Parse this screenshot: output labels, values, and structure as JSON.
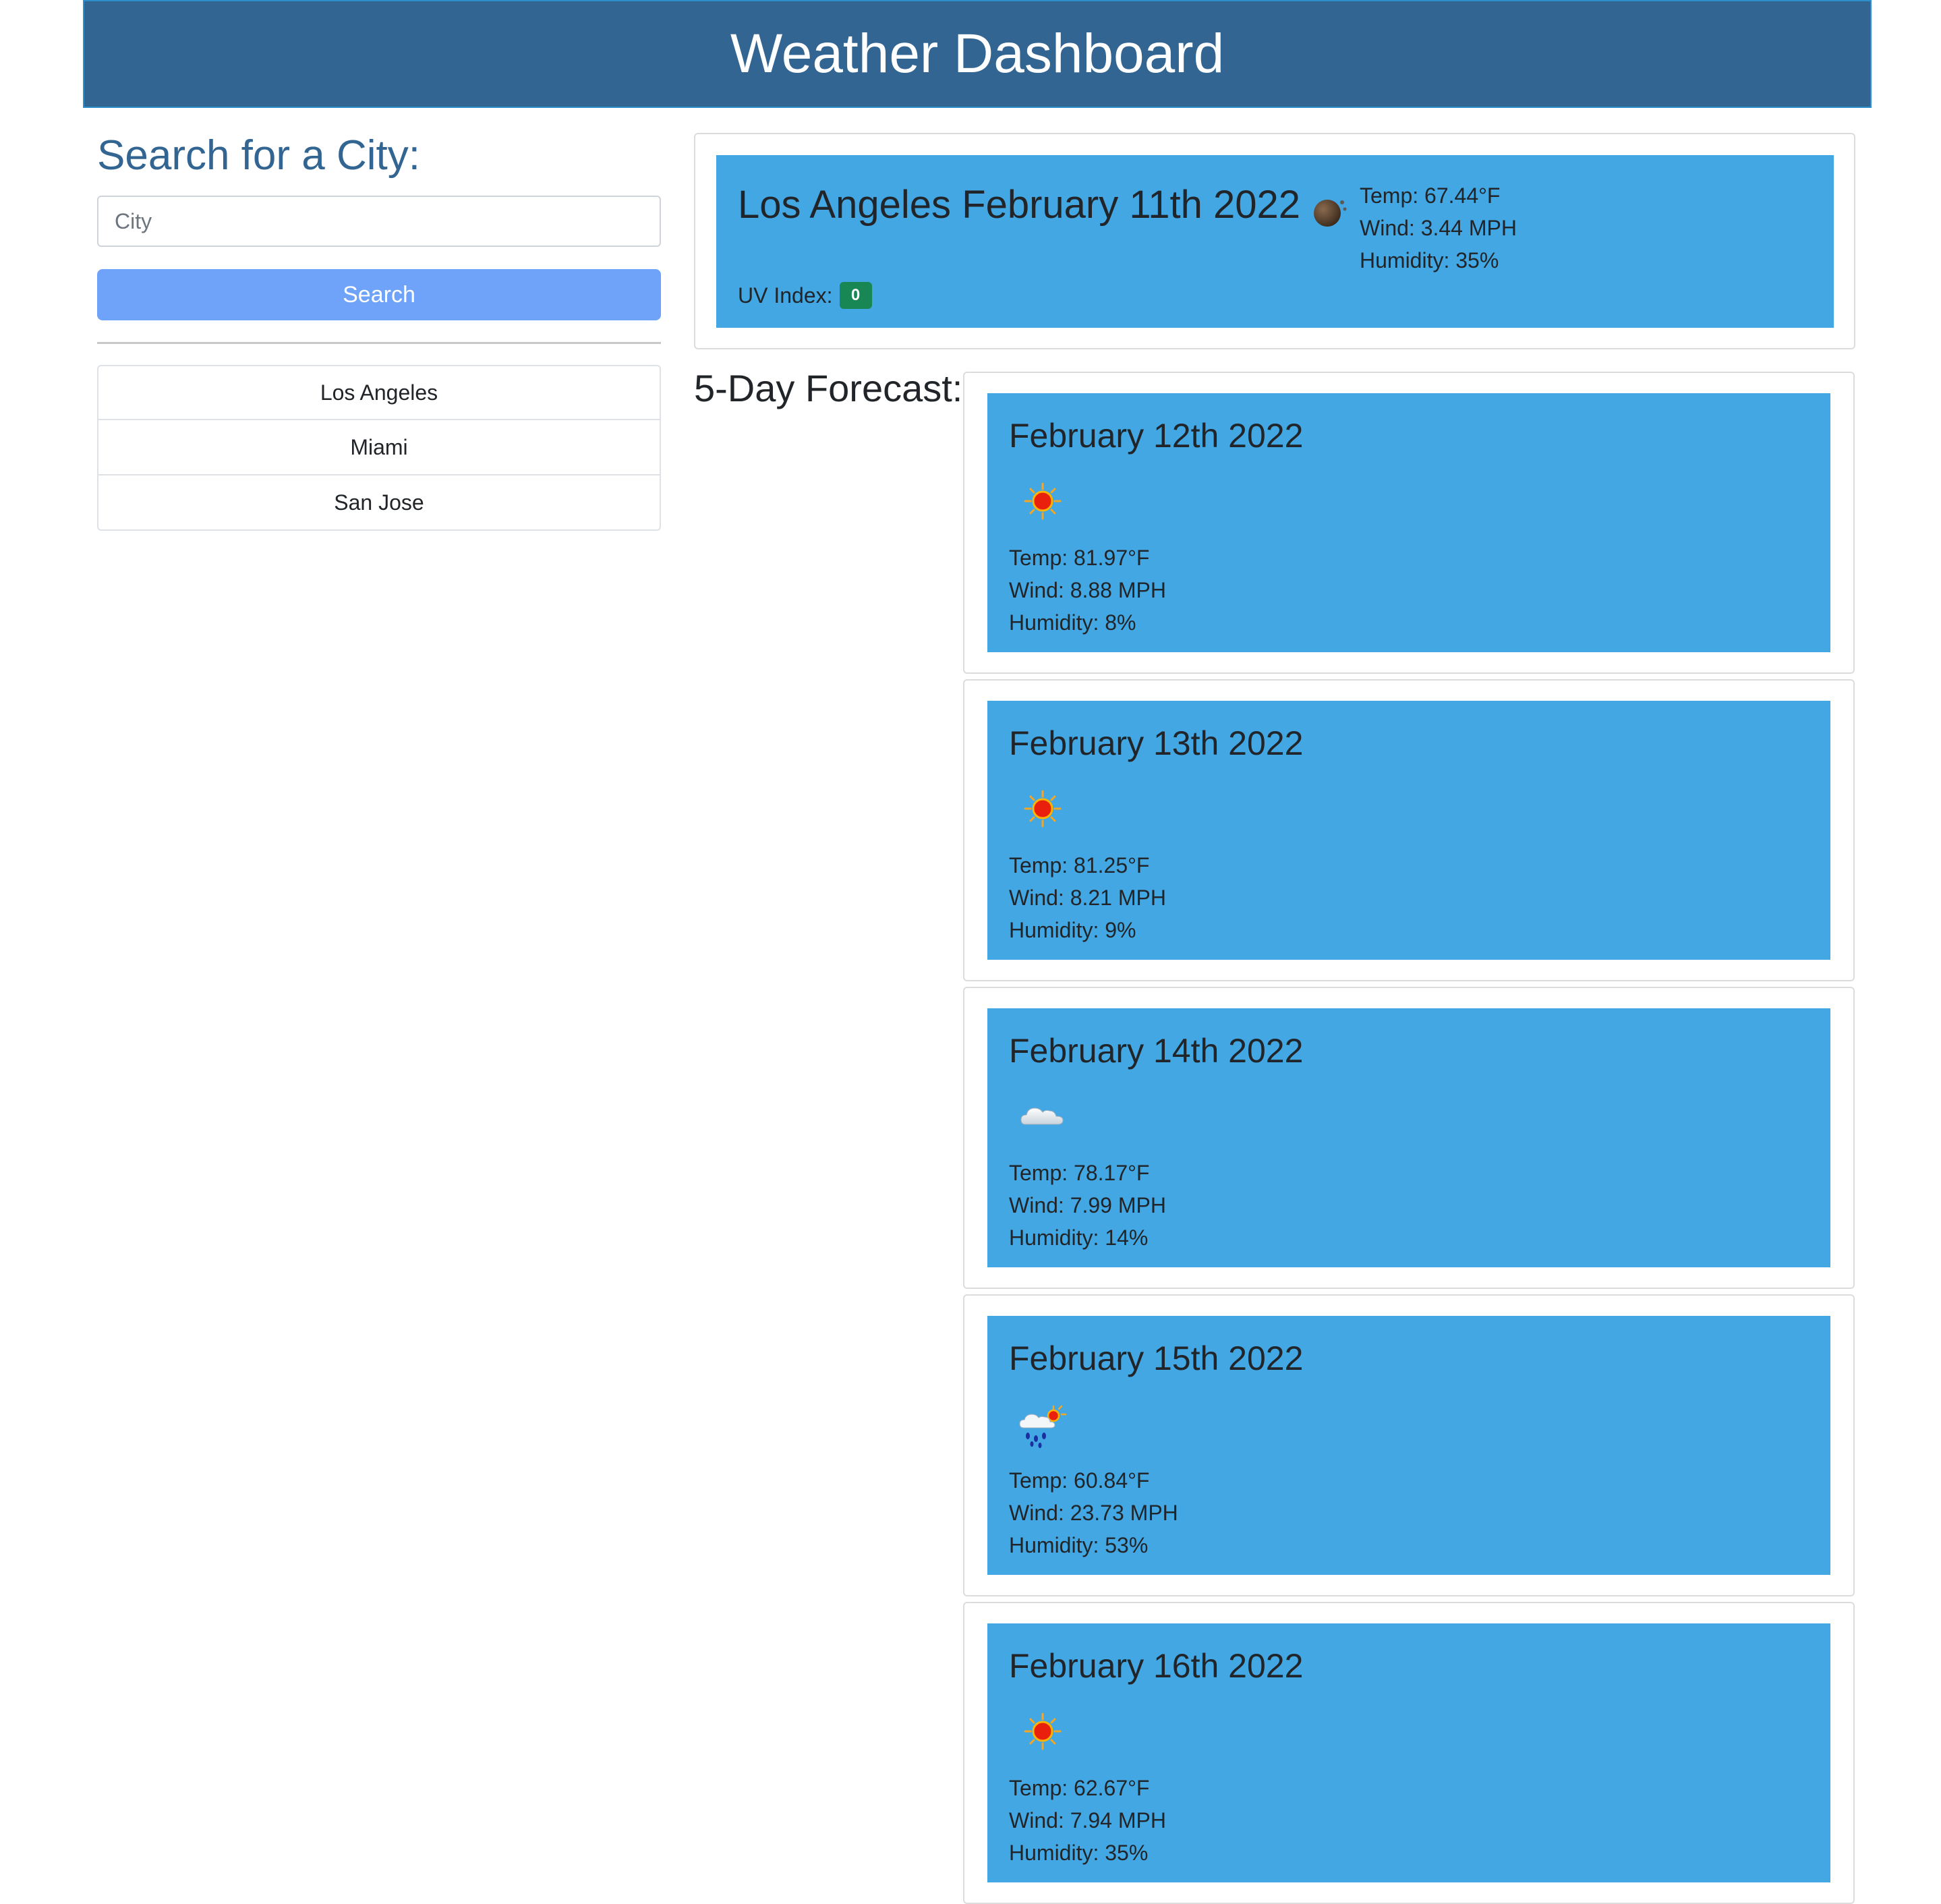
{
  "header": {
    "title": "Weather Dashboard"
  },
  "search": {
    "title": "Search for a City:",
    "placeholder": "City",
    "value": "",
    "button_label": "Search"
  },
  "history": [
    "Los Angeles",
    "Miami",
    "San Jose"
  ],
  "current": {
    "heading": "Los Angeles February 11th 2022",
    "icon": "night-clear-icon",
    "temp": "Temp: 67.44°F",
    "wind": "Wind: 3.44 MPH",
    "humidity": "Humidity: 35%",
    "uv_label": "UV Index:",
    "uv_value": "0",
    "uv_color": "#198754"
  },
  "forecast_title": "5-Day Forecast:",
  "forecast": [
    {
      "date": "February 12th 2022",
      "icon": "sun-icon",
      "temp": "Temp: 81.97°F",
      "wind": "Wind: 8.88 MPH",
      "humidity": "Humidity: 8%"
    },
    {
      "date": "February 13th 2022",
      "icon": "sun-icon",
      "temp": "Temp: 81.25°F",
      "wind": "Wind: 8.21 MPH",
      "humidity": "Humidity: 9%"
    },
    {
      "date": "February 14th 2022",
      "icon": "cloud-icon",
      "temp": "Temp: 78.17°F",
      "wind": "Wind: 7.99 MPH",
      "humidity": "Humidity: 14%"
    },
    {
      "date": "February 15th 2022",
      "icon": "rain-sun-icon",
      "temp": "Temp: 60.84°F",
      "wind": "Wind: 23.73 MPH",
      "humidity": "Humidity: 53%"
    },
    {
      "date": "February 16th 2022",
      "icon": "sun-icon",
      "temp": "Temp: 62.67°F",
      "wind": "Wind: 7.94 MPH",
      "humidity": "Humidity: 35%"
    }
  ],
  "colors": {
    "header_bg": "#336592",
    "card_bg": "#42a7e2",
    "search_button": "#6ea3f9",
    "heading_text": "#336592"
  }
}
